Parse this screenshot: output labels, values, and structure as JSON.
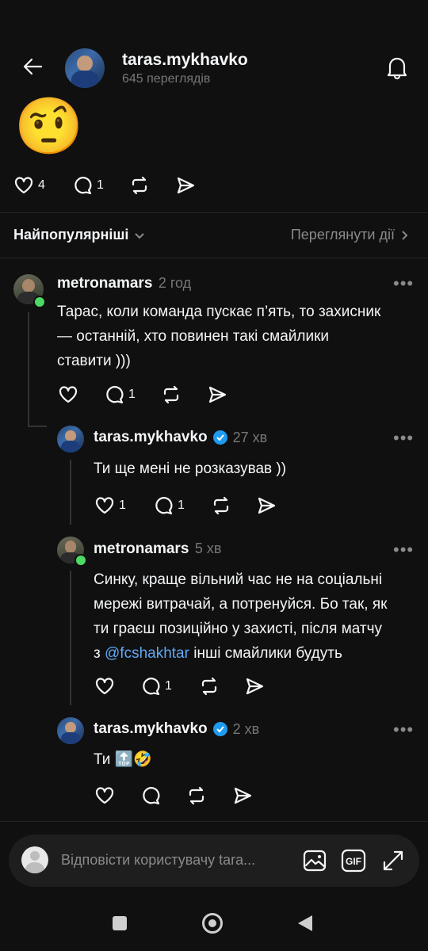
{
  "header": {
    "username": "taras.mykhavko",
    "views": "645 переглядів"
  },
  "post": {
    "emoji": "🤨",
    "likes": "4",
    "comments": "1"
  },
  "sort": {
    "label": "Найпопулярніші",
    "activity_link": "Переглянути дії"
  },
  "comments": [
    {
      "username": "metronamars",
      "time": "2 год",
      "lines": [
        "Тарас, коли команда пускає п’ять, то захисник",
        "— останній, хто повинен такі смайлики",
        "ставити )))"
      ],
      "likes": "",
      "replies": "1"
    },
    {
      "username": "taras.mykhavko",
      "time": "27 хв",
      "lines": [
        "Ти ще мені не розказував ))"
      ],
      "likes": "1",
      "replies": "1"
    },
    {
      "username": "metronamars",
      "time": "5 хв",
      "lines": [
        "Синку, краще вільний час не на соціальні",
        "мережі витрачай, а потренуйся. Бо так, як",
        "ти граєш позиційно у захисті, після матчу"
      ],
      "line4_prefix": "з ",
      "mention": "@fcshakhtar",
      "line4_suffix": " інші смайлики будуть",
      "likes": "",
      "replies": "1"
    },
    {
      "username": "taras.mykhavko",
      "time": "2 хв",
      "text": "Ти ",
      "emojis": "🔝🤣",
      "likes": "",
      "replies": ""
    }
  ],
  "reply_bar": {
    "placeholder": "Відповісти користувачу tara..."
  },
  "colors": {
    "background": "#101010",
    "mention": "#5fa8f5",
    "verified": "#1d9bf0",
    "online": "#4cd964"
  }
}
